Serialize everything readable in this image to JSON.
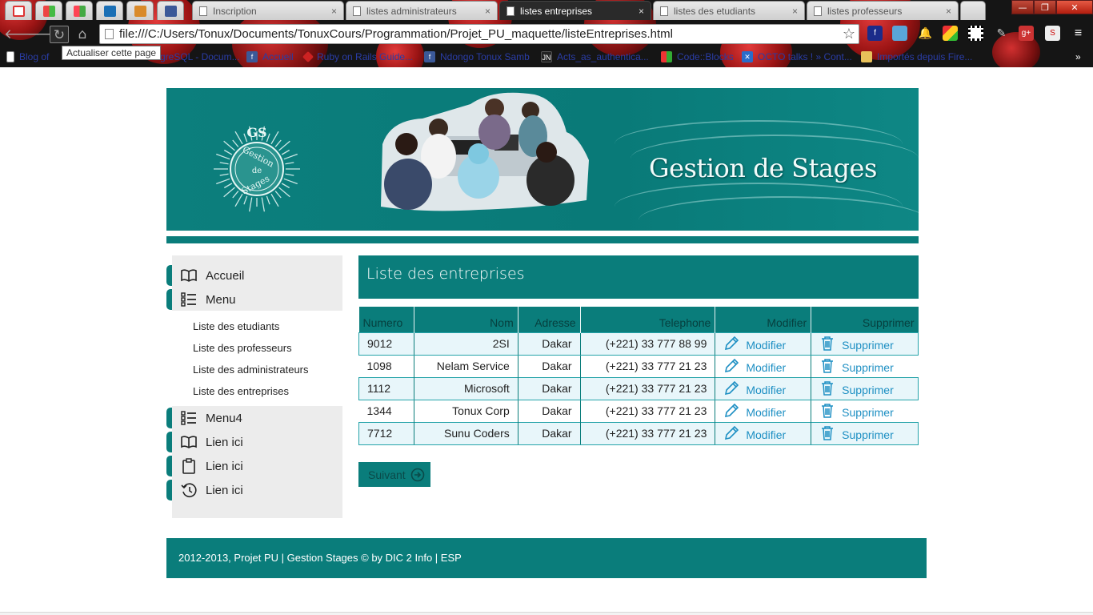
{
  "browser": {
    "tabs": [
      {
        "label": "Inscription",
        "active": false
      },
      {
        "label": "listes administrateurs",
        "active": false
      },
      {
        "label": "listes entreprises",
        "active": true
      },
      {
        "label": "listes des etudiants",
        "active": false
      },
      {
        "label": "listes professeurs",
        "active": false
      }
    ],
    "pinned_tabs": [
      "gmail-icon",
      "windows-icon",
      "microsoft-icon",
      "trello-icon",
      "app-icon",
      "facebook-icon"
    ],
    "address": "file:///C:/Users/Tonux/Documents/TonuxCours/Programmation/Projet_PU_maquette/listeEntreprises.html",
    "tooltip": "Actualiser cette page",
    "close_glyph": "×",
    "bookmarks": [
      {
        "label": "Blog of",
        "icon": "page-icon"
      },
      {
        "label": "greSQL - Docum...",
        "icon": "page-icon"
      },
      {
        "label": "Accueil",
        "icon": "facebook-icon"
      },
      {
        "label": "Ruby on Rails Guide...",
        "icon": "ruby-icon"
      },
      {
        "label": "Ndongo Tonux Samb",
        "icon": "facebook-icon"
      },
      {
        "label": "Acts_as_authentica...",
        "icon": "jn-icon"
      },
      {
        "label": "Code::Blocks",
        "icon": "codeblocks-icon"
      },
      {
        "label": "OCTO talks ! » Cont...",
        "icon": "octo-icon"
      },
      {
        "label": "Importés depuis Fire...",
        "icon": "folder-icon"
      }
    ],
    "overflow_glyph": "»",
    "window_controls": {
      "minimize": "—",
      "maximize": "❐",
      "close": "✕"
    }
  },
  "banner": {
    "title": "Gestion de Stages",
    "logo_text": [
      "GS",
      "Gestion",
      "de",
      "Stages"
    ]
  },
  "sidebar": {
    "items_top": [
      {
        "label": "Accueil",
        "icon": "book-icon"
      },
      {
        "label": "Menu",
        "icon": "list-icon"
      }
    ],
    "submenu": [
      "Liste des etudiants",
      "Liste des professeurs",
      "Liste des administrateurs",
      "Liste des entreprises"
    ],
    "items_bottom": [
      {
        "label": "Menu4",
        "icon": "list-icon"
      },
      {
        "label": "Lien ici",
        "icon": "book-icon"
      },
      {
        "label": "Lien ici",
        "icon": "clipboard-icon"
      },
      {
        "label": "Lien ici",
        "icon": "history-icon"
      }
    ]
  },
  "main": {
    "title": "Liste des entreprises",
    "table": {
      "columns": [
        "Numero",
        "Nom",
        "Adresse",
        "Telephone",
        "Modifier",
        "Supprimer"
      ],
      "rows": [
        {
          "numero": "9012",
          "nom": "2SI",
          "adresse": "Dakar",
          "telephone": "(+221) 33 777 88 99"
        },
        {
          "numero": "1098",
          "nom": "Nelam Service",
          "adresse": "Dakar",
          "telephone": "(+221) 33 777 21 23"
        },
        {
          "numero": "1112",
          "nom": "Microsoft",
          "adresse": "Dakar",
          "telephone": "(+221) 33 777 21 23"
        },
        {
          "numero": "1344",
          "nom": "Tonux Corp",
          "adresse": "Dakar",
          "telephone": "(+221) 33 777 21 23"
        },
        {
          "numero": "7712",
          "nom": "Sunu Coders",
          "adresse": "Dakar",
          "telephone": "(+221) 33 777 21 23"
        }
      ],
      "edit_label": "Modifier",
      "delete_label": "Supprimer"
    },
    "next_label": "Suivant"
  },
  "footer": {
    "text": "2012-2013, Projet PU | Gestion Stages © by DIC 2 Info | ESP"
  },
  "colors": {
    "teal": "#0a7d7b",
    "link": "#1d8fc3",
    "row_highlight": "#e8f6fa"
  }
}
